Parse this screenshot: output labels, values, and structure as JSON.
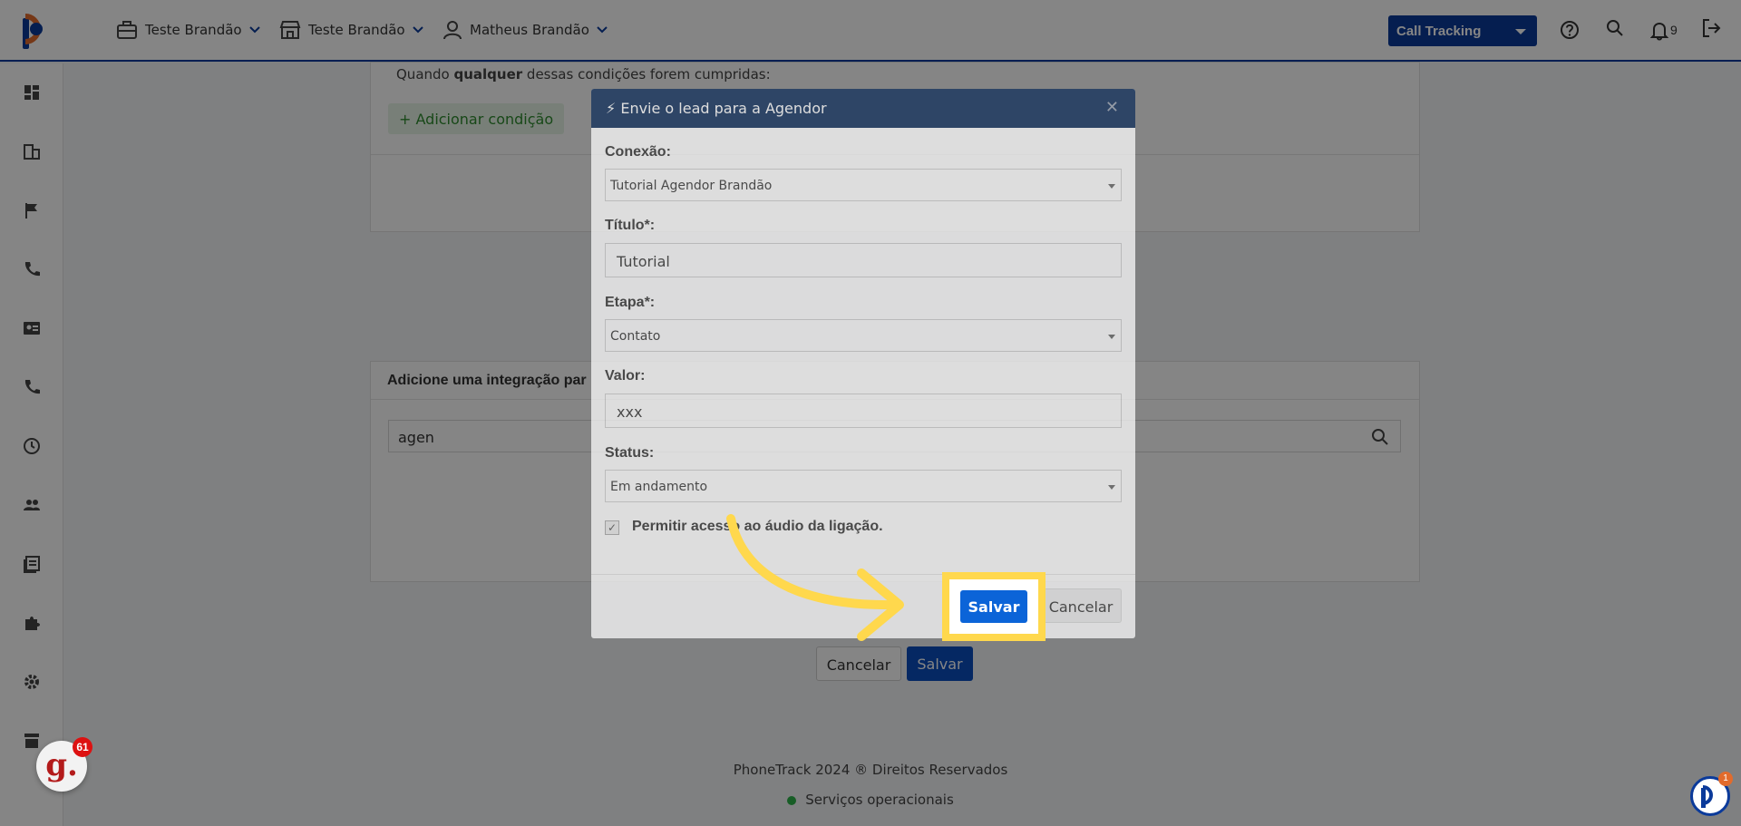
{
  "header": {
    "account": "Teste Brandão",
    "store": "Teste Brandão",
    "user": "Matheus Brandão",
    "product_select": "Call Tracking",
    "notifications_count": "9"
  },
  "sidebar": {
    "icons": [
      "dashboard-icon",
      "company-icon",
      "flag-icon",
      "phone-icon",
      "contact-card-icon",
      "phone-call-icon",
      "clock-icon",
      "users-icon",
      "book-icon",
      "puzzle-icon",
      "gear-icon",
      "store-icon"
    ]
  },
  "main": {
    "condition_text_pre": "Quando ",
    "condition_text_bold": "qualquer",
    "condition_text_post": " dessas condições forem cumpridas:",
    "add_condition": "+ Adicionar condição",
    "integration_header": "Adicione uma integração par",
    "search_value": "agen",
    "cancel_label": "Cancelar",
    "save_label": "Salvar"
  },
  "footer": {
    "copyright": "PhoneTrack 2024 ® Direitos Reservados",
    "status": "Serviços operacionais"
  },
  "modal": {
    "title": "Envie o lead para a Agendor",
    "conexao_label": "Conexão:",
    "conexao_value": "Tutorial Agendor Brandão",
    "titulo_label": "Título*:",
    "titulo_value": "Tutorial",
    "etapa_label": "Etapa*:",
    "etapa_value": "Contato",
    "valor_label": "Valor:",
    "valor_value": "xxx",
    "status_label": "Status:",
    "status_value": "Em andamento",
    "audio_label": "Permitir acesso ao áudio da ligação.",
    "save_label": "Salvar",
    "cancel_label": "Cancelar"
  },
  "widgets": {
    "g_badge_letter": "g.",
    "g_badge_count": "61",
    "chat_badge_count": "1"
  },
  "colors": {
    "brand_blue": "#0b3a9a",
    "modal_header": "#0d2d5b",
    "highlight_yellow": "#ffd84d",
    "primary_button": "#0b64d8"
  }
}
